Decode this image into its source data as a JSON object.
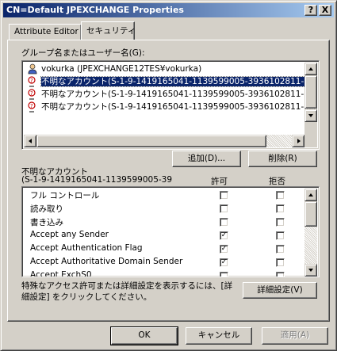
{
  "window": {
    "title": "CN=Default JPEXCHANGE Properties",
    "help_label": "?",
    "close_label": "X"
  },
  "tabs": [
    {
      "label": "Attribute Editor",
      "active": false
    },
    {
      "label": "セキュリティ",
      "active": true
    }
  ],
  "users": {
    "label": "グループ名またはユーザー名(G):",
    "items": [
      {
        "text": "vokurka (JPEXCHANGE12TES¥vokurka)",
        "icon": "user-icon",
        "selected": false
      },
      {
        "text": "不明なアカウント(S-1-9-1419165041-1139599005-3936102811-10",
        "icon": "unknown-user-icon",
        "selected": true
      },
      {
        "text": "不明なアカウント(S-1-9-1419165041-1139599005-3936102811-10",
        "icon": "unknown-user-icon",
        "selected": false
      },
      {
        "text": "不明なアカウント(S-1-9-1419165041-1139599005-3936102811-10",
        "icon": "unknown-user-icon",
        "selected": false
      }
    ],
    "add_button": "追加(D)...",
    "remove_button": "削除(R)"
  },
  "permissions": {
    "account_line1": "不明なアカウント",
    "account_line2": "(S-1-9-1419165041-1139599005-39",
    "allow_header": "許可",
    "deny_header": "拒否",
    "rows": [
      {
        "name": "フル コントロール",
        "allow": false,
        "deny": false
      },
      {
        "name": "読み取り",
        "allow": false,
        "deny": false
      },
      {
        "name": "書き込み",
        "allow": false,
        "deny": false
      },
      {
        "name": "Accept any Sender",
        "allow": true,
        "deny": false
      },
      {
        "name": "Accept Authentication Flag",
        "allow": true,
        "deny": false
      },
      {
        "name": "Accept Authoritative Domain Sender",
        "allow": true,
        "deny": false
      },
      {
        "name": "Accept ExchS0",
        "allow": false,
        "deny": false
      }
    ]
  },
  "advanced": {
    "note": "特殊なアクセス許可または詳細設定を表示するには、[詳細設定] をクリックしてください。",
    "button": "詳細設定(V)"
  },
  "footer": {
    "ok": "OK",
    "cancel": "キャンセル",
    "apply": "適用(A)"
  },
  "colors": {
    "titlebar_start": "#0a246a",
    "titlebar_end": "#a6caf0",
    "selection": "#0a246a",
    "face": "#d4d0c8"
  }
}
